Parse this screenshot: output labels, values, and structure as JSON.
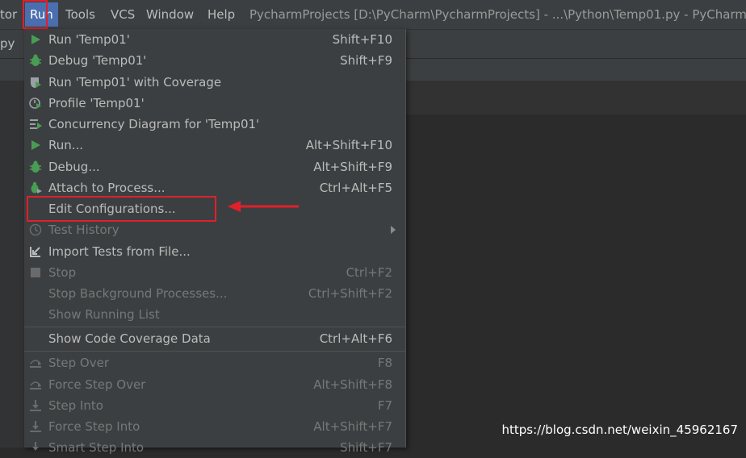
{
  "menubar": {
    "items": [
      "tor",
      "Run",
      "Tools",
      "VCS",
      "Window",
      "Help"
    ],
    "title": "PycharmProjects [D:\\PyCharm\\PycharmProjects] - ...\\Python\\Temp01.py - PyCharm"
  },
  "tab_fragment": "py",
  "run_menu": {
    "items": [
      {
        "label": "Run 'Temp01'",
        "shortcut": "Shift+F10",
        "icon": "run-icon"
      },
      {
        "label": "Debug 'Temp01'",
        "shortcut": "Shift+F9",
        "icon": "debug-icon"
      },
      {
        "label": "Run 'Temp01' with Coverage",
        "shortcut": "",
        "icon": "coverage-icon"
      },
      {
        "label": "Profile 'Temp01'",
        "shortcut": "",
        "icon": "profile-icon"
      },
      {
        "label": "Concurrency Diagram for 'Temp01'",
        "shortcut": "",
        "icon": "concurrency-icon"
      },
      {
        "label": "Run...",
        "shortcut": "Alt+Shift+F10",
        "icon": "run-icon"
      },
      {
        "label": "Debug...",
        "shortcut": "Alt+Shift+F9",
        "icon": "debug-icon"
      },
      {
        "label": "Attach to Process...",
        "shortcut": "Ctrl+Alt+F5",
        "icon": "attach-icon"
      },
      {
        "label": "Edit Configurations...",
        "shortcut": "",
        "icon": ""
      },
      {
        "label": "Test History",
        "shortcut": "",
        "icon": "history-icon"
      },
      {
        "label": "Import Tests from File...",
        "shortcut": "",
        "icon": "import-icon"
      },
      {
        "label": "Stop",
        "shortcut": "Ctrl+F2",
        "icon": "stop-icon"
      },
      {
        "label": "Stop Background Processes...",
        "shortcut": "Ctrl+Shift+F2",
        "icon": ""
      },
      {
        "label": "Show Running List",
        "shortcut": "",
        "icon": ""
      },
      {
        "label": "Show Code Coverage Data",
        "shortcut": "Ctrl+Alt+F6",
        "icon": ""
      },
      {
        "label": "Step Over",
        "shortcut": "F8",
        "icon": "step-over-icon"
      },
      {
        "label": "Force Step Over",
        "shortcut": "Alt+Shift+F8",
        "icon": "force-step-over-icon"
      },
      {
        "label": "Step Into",
        "shortcut": "F7",
        "icon": "step-into-icon"
      },
      {
        "label": "Force Step Into",
        "shortcut": "Alt+Shift+F7",
        "icon": "force-step-into-icon"
      },
      {
        "label": "Smart Step Into",
        "shortcut": "Shift+F7",
        "icon": "smart-step-into-icon"
      }
    ]
  },
  "watermark": "https://blog.csdn.net/weixin_45962167",
  "colors": {
    "menu_bg": "#3c3f41",
    "editor_bg": "#2b2b2b",
    "active_menu": "#4b6eaf",
    "annotation_red": "#e0202a",
    "run_green": "#499c54"
  }
}
